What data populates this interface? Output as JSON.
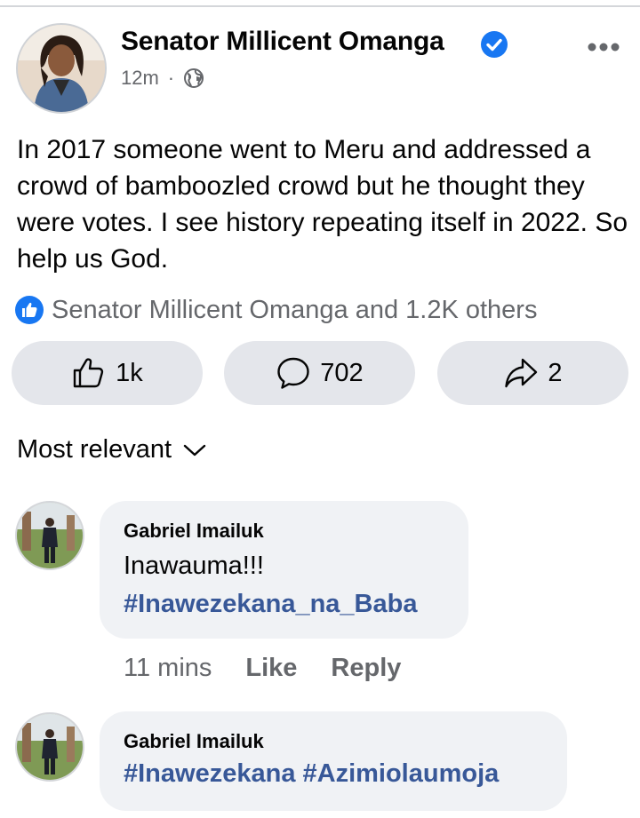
{
  "post": {
    "author": "Senator Millicent Omanga",
    "time": "12m",
    "separator": "·",
    "text": "In 2017 someone went to Meru and addressed a crowd of bamboozled crowd but he thought they were votes. I see history repeating itself in 2022. So help us God.",
    "reactions_summary": "Senator Millicent Omanga and 1.2K others",
    "like_count": "1k",
    "comment_count": "702",
    "share_count": "2"
  },
  "comments_sort": {
    "label": "Most relevant"
  },
  "comments": [
    {
      "name": "Gabriel Imailuk",
      "text": "Inawauma!!!",
      "tags": "#Inawezekana_na_Baba",
      "time": "11 mins",
      "like_label": "Like",
      "reply_label": "Reply"
    },
    {
      "name": "Gabriel Imailuk",
      "tags": "#Inawezekana #Azimiolaumoja"
    }
  ],
  "colors": {
    "verified_blue": "#1877f2",
    "tag_blue": "#385898",
    "secondary_text": "#65676b",
    "button_bg": "#e4e6eb",
    "bubble_bg": "#f0f2f5"
  },
  "icons": [
    "verified-badge-icon",
    "globe-icon",
    "more-options-icon",
    "like-reaction-icon",
    "thumbs-up-icon",
    "comment-icon",
    "share-icon",
    "chevron-down-icon"
  ]
}
